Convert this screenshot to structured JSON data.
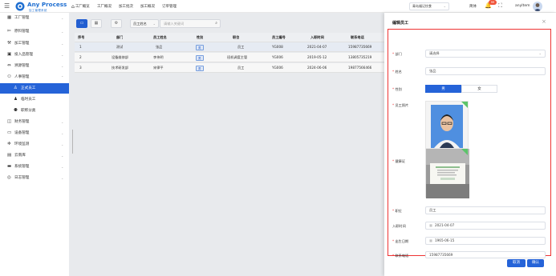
{
  "header": {
    "brand_name": "Any Process",
    "brand_sub": "加工管理系统",
    "nav": [
      "工厂概览",
      "工厂概况",
      "加工批次",
      "加工概况",
      "订单管理"
    ],
    "enterprise_select": "青岛福记饮食",
    "lang": "简体",
    "notification_count": "99",
    "username": "anyItem"
  },
  "sidebar": {
    "items": [
      {
        "label": "工厂管理",
        "icon": "grid-icon"
      },
      {
        "label": "原料管理",
        "icon": "leaf-icon"
      },
      {
        "label": "加工管理",
        "icon": "hammer-icon"
      },
      {
        "label": "投入品管理",
        "icon": "box-icon"
      },
      {
        "label": "溯源管理",
        "icon": "link-icon"
      },
      {
        "label": "人事管理",
        "icon": "people-icon"
      },
      {
        "label": "正式员工",
        "icon": "person-icon"
      },
      {
        "label": "临时员工",
        "icon": "person-icon"
      },
      {
        "label": "职称分类",
        "icon": "group-icon"
      },
      {
        "label": "财务管理",
        "icon": "wallet-icon"
      },
      {
        "label": "设备管理",
        "icon": "device-icon"
      },
      {
        "label": "环境监测",
        "icon": "gear-icon"
      },
      {
        "label": "云南库",
        "icon": "folder-icon"
      },
      {
        "label": "系统管理",
        "icon": "monitor-icon"
      },
      {
        "label": "日志管理",
        "icon": "log-icon"
      }
    ]
  },
  "toolbar": {
    "field_select": "员工姓名",
    "keyword_placeholder": "请输入关键词"
  },
  "table": {
    "headers": [
      "序号",
      "部门",
      "员工姓名",
      "性别",
      "职位",
      "员工编号",
      "入职时间",
      "联系电话"
    ],
    "rows": [
      [
        "1",
        "测试",
        "张品",
        "男",
        "员工",
        "YG008",
        "2021-04-07",
        "15987735669"
      ],
      [
        "2",
        "设备维修部",
        "李伟明",
        "男",
        "班机调度主管",
        "YG006",
        "2019-05-12",
        "13805735219"
      ],
      [
        "3",
        "技术研发部",
        "宋律平",
        "男",
        "员工",
        "YG006",
        "2024-06-06",
        "19877566466"
      ]
    ]
  },
  "drawer": {
    "title": "编辑员工",
    "dept_label": "部门",
    "dept_value": "请选择",
    "name_label": "姓名",
    "name_value": "张品",
    "gender_label": "性别",
    "gender_male": "男",
    "gender_female": "女",
    "photo_label": "员工照片",
    "health_label": "健康证",
    "position_label": "职位",
    "position_value": "员工",
    "hire_label": "入职时间",
    "hire_value": "2021-04-07",
    "birth_label": "出生日期",
    "birth_value": "1965-06-15",
    "phone_label": "联系电话",
    "phone_value": "15987735669",
    "cancel": "取消",
    "confirm": "确认"
  },
  "colors": {
    "primary": "#2563d8",
    "highlight_border": "#e33333",
    "ok": "#5cc46a"
  }
}
